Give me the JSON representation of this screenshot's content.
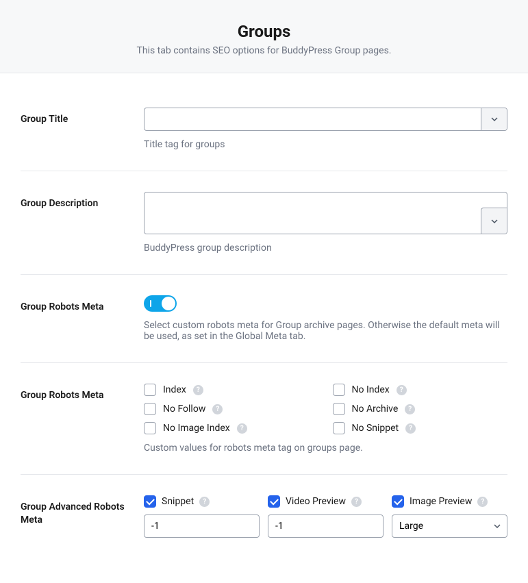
{
  "header": {
    "title": "Groups",
    "subtitle": "This tab contains SEO options for BuddyPress Group pages."
  },
  "fields": {
    "group_title": {
      "label": "Group Title",
      "value": "",
      "desc": "Title tag for groups"
    },
    "group_description": {
      "label": "Group Description",
      "value": "",
      "desc": "BuddyPress group description"
    },
    "robots_toggle": {
      "label": "Group Robots Meta",
      "state": "on",
      "desc": "Select custom robots meta for Group archive pages. Otherwise the default meta will be used, as set in the Global Meta tab."
    },
    "robots_checks": {
      "label": "Group Robots Meta",
      "options": [
        {
          "label": "Index",
          "checked": false
        },
        {
          "label": "No Index",
          "checked": false
        },
        {
          "label": "No Follow",
          "checked": false
        },
        {
          "label": "No Archive",
          "checked": false
        },
        {
          "label": "No Image Index",
          "checked": false
        },
        {
          "label": "No Snippet",
          "checked": false
        }
      ],
      "desc": "Custom values for robots meta tag on groups page."
    },
    "advanced": {
      "label": "Group Advanced Robots Meta",
      "snippet": {
        "label": "Snippet",
        "checked": true,
        "value": "-1"
      },
      "video": {
        "label": "Video Preview",
        "checked": true,
        "value": "-1"
      },
      "image": {
        "label": "Image Preview",
        "checked": true,
        "value": "Large"
      }
    }
  }
}
